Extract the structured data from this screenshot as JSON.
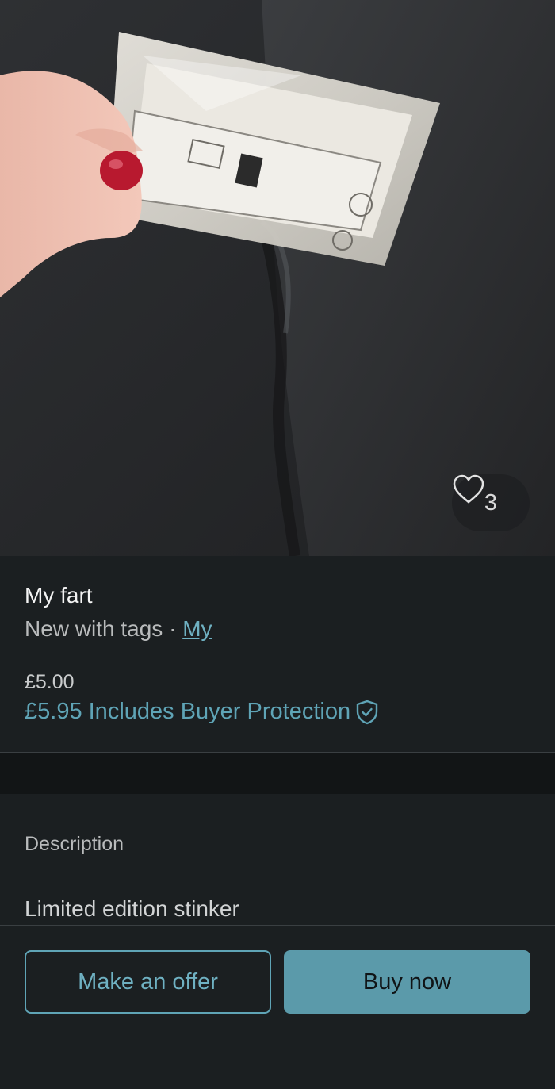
{
  "listing": {
    "title": "My fart",
    "condition": "New with tags",
    "separator": " · ",
    "brand": "My",
    "price": "£5.00",
    "price_with_protection": "£5.95 Includes Buyer Protection",
    "favourites_count": "3",
    "photo_description": "hand holding a small sealed plastic packet on dark jeans"
  },
  "description": {
    "label": "Description",
    "text": "Limited edition stinker"
  },
  "actions": {
    "offer_label": "Make an offer",
    "buy_label": "Buy now"
  },
  "icons": {
    "favourite": "heart-outline-icon",
    "protection": "shield-check-icon"
  },
  "colors": {
    "accent": "#5fa4b6",
    "background": "#1b1f21",
    "band": "#121516",
    "buy_button": "#5b9aaa"
  }
}
